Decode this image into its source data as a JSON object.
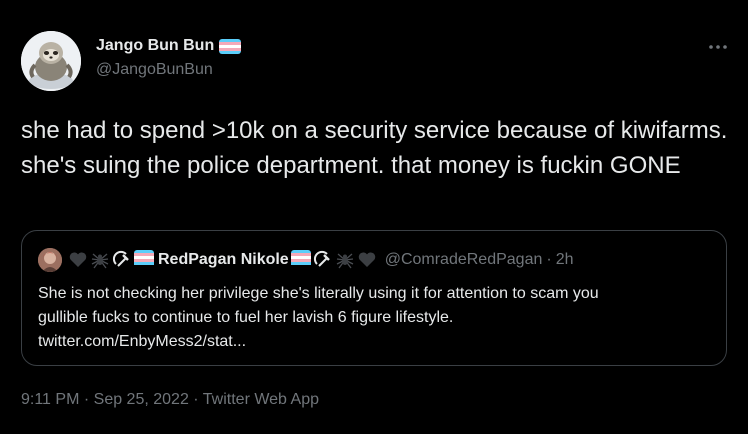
{
  "author": {
    "display_name": "Jango Bun Bun",
    "handle": "@JangoBunBun",
    "flag_icon": "transgender-flag-icon",
    "avatar_icon": "sloth-avatar-icon"
  },
  "menu": {
    "more_icon": "more-options-icon",
    "glyph": "•••"
  },
  "tweet": {
    "text": "she had to spend >10k on a security service because of kiwifarms. she's suing the police department. that money is fuckin GONE"
  },
  "quote": {
    "display_name": "RedPagan Nikole",
    "handle": "@ComradeRedPagan",
    "separator": "·",
    "time": "2h",
    "emojis_before": [
      "black-heart-icon",
      "spider-icon",
      "hammer-sickle-icon",
      "transgender-flag-icon"
    ],
    "emojis_after": [
      "transgender-flag-icon",
      "hammer-sickle-icon",
      "spider-icon",
      "black-heart-icon"
    ],
    "text_line1": "She is not checking her privilege she's literally using it for attention to scam you",
    "text_line2": "gullible fucks to continue to fuel her lavish 6 figure lifestyle.",
    "link": "twitter.com/EnbyMess2/stat..."
  },
  "meta": {
    "time": "9:11 PM",
    "sep1": "·",
    "date": "Sep 25, 2022",
    "sep2": "·",
    "source": "Twitter Web App"
  },
  "colors": {
    "background": "#000000",
    "text_primary": "#e7e9ea",
    "text_secondary": "#71767b",
    "border": "#3a3f44",
    "trans_blue": "#5bcefa",
    "trans_pink": "#f5a9b8"
  }
}
